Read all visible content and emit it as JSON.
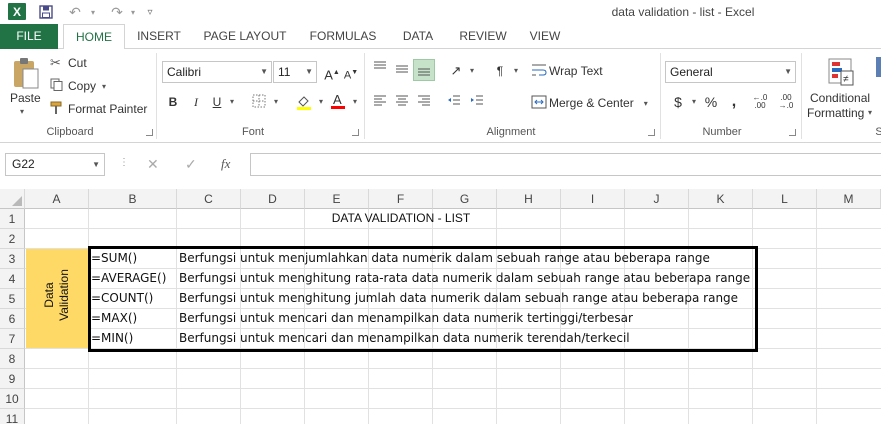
{
  "window": {
    "title": "data validation - list - Excel",
    "app_icon": "X"
  },
  "ribbon_tabs": [
    "FILE",
    "HOME",
    "INSERT",
    "PAGE LAYOUT",
    "FORMULAS",
    "DATA",
    "REVIEW",
    "VIEW"
  ],
  "clipboard": {
    "paste": "Paste",
    "cut": "Cut",
    "copy": "Copy",
    "format_painter": "Format Painter",
    "label": "Clipboard"
  },
  "font": {
    "name": "Calibri",
    "size": "11",
    "label": "Font"
  },
  "alignment": {
    "wrap_text": "Wrap Text",
    "merge_center": "Merge & Center",
    "label": "Alignment"
  },
  "number": {
    "format": "General",
    "label": "Number"
  },
  "styles": {
    "conditional_formatting_1": "Conditional",
    "conditional_formatting_2": "Formatting",
    "partial_label": "S"
  },
  "formula_bar": {
    "name_box": "G22",
    "fx": "fx",
    "formula": ""
  },
  "columns": [
    "A",
    "B",
    "C",
    "D",
    "E",
    "F",
    "G",
    "H",
    "I",
    "J",
    "K",
    "L",
    "M"
  ],
  "rows": [
    "1",
    "2",
    "3",
    "4",
    "5",
    "6",
    "7",
    "8",
    "9",
    "10",
    "11"
  ],
  "sheet": {
    "title": "DATA VALIDATION - LIST",
    "side_label_1": "Data",
    "side_label_2": "Validation",
    "side_label_color": "#FFD966",
    "functions": [
      "=SUM()",
      "=AVERAGE()",
      "=COUNT()",
      "=MAX()",
      "=MIN()"
    ],
    "descriptions": [
      "Berfungsi untuk menjumlahkan data numerik dalam sebuah range atau beberapa range",
      "Berfungsi untuk menghitung rata-rata data numerik dalam sebuah range atau beberapa range",
      "Berfungsi untuk menghitung jumlah data numerik dalam sebuah range atau beberapa range",
      "Berfungsi untuk mencari dan menampilkan data numerik tertinggi/terbesar",
      "Berfungsi untuk mencari dan menampilkan data numerik terendah/terkecil"
    ]
  },
  "accent_color": "#217346"
}
